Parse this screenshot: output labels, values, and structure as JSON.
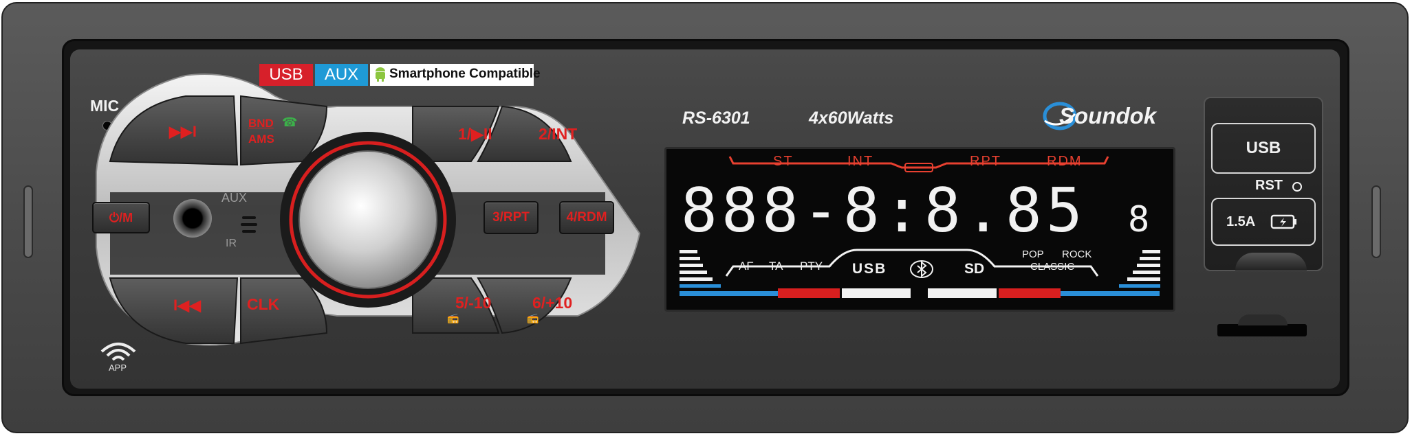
{
  "front_panel": {
    "mic_label": "MIC",
    "badges": {
      "usb": "USB",
      "aux": "AUX",
      "smartphone": "Smartphone Compatible"
    },
    "model": "RS-6301",
    "power_rating": "4x60Watts",
    "brand": "Soundok",
    "aux_jack_label": "AUX",
    "ir_label": "IR",
    "app_label": "APP"
  },
  "buttons": {
    "next": "▶▶I",
    "bnd_ams_top": "BND",
    "bnd_ams_bottom": "AMS",
    "preset1": "1/▶II",
    "preset2": "2/INT",
    "power_mode": "⏻/M",
    "preset3": "3/RPT",
    "preset4": "4/RDM",
    "prev": "I◀◀",
    "clk": "CLK",
    "preset5": "5/-10",
    "preset6": "6/+10"
  },
  "display": {
    "indicators": [
      "ST",
      "INT",
      "RPT",
      "RDM"
    ],
    "segment_text": "888-8:8.85",
    "segment_small": "8",
    "bottom_left": [
      "AF",
      "TA",
      "PTY"
    ],
    "usb": "USB",
    "sd": "SD",
    "eq_top": [
      "POP",
      "ROCK"
    ],
    "eq_bottom": "CLASSIC"
  },
  "right_panel": {
    "usb_button": "USB",
    "rst_label": "RST",
    "charge_label": "1.5A"
  },
  "colors": {
    "accent_red": "#e02020",
    "usb_badge": "#d7202a",
    "aux_badge": "#1f9ad6",
    "lcd_red": "#e84030",
    "lcd_blue": "#2a8fd8",
    "lcd_white": "#f2f2f2"
  }
}
